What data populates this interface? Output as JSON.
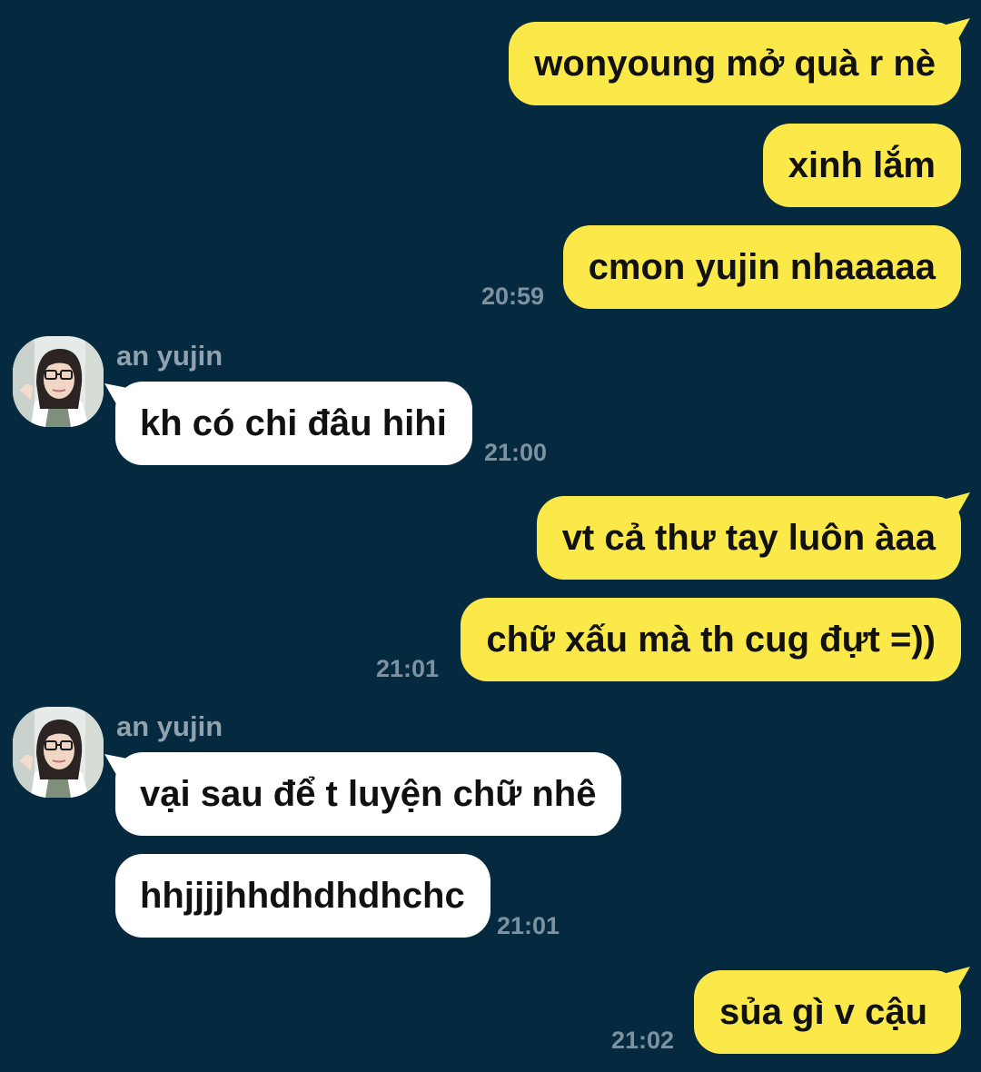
{
  "theme": {
    "background": "#052a40",
    "outgoing_bubble": "#fbe94a",
    "incoming_bubble": "#ffffff",
    "timestamp_color": "#7d92a0",
    "sender_color": "#8fa2ad"
  },
  "messages": [
    {
      "text": "wonyoung mở quà r nè"
    },
    {
      "text": "xinh lắm"
    },
    {
      "text": "cmon yujin nhaaaaa",
      "time": "20:59"
    },
    {
      "sender": "an yujin",
      "text": "kh có chi đâu hihi",
      "time": "21:00"
    },
    {
      "text": "vt cả thư tay luôn àaa"
    },
    {
      "text": "chữ xấu mà th cug đựt =))",
      "time": "21:01"
    },
    {
      "sender": "an yujin",
      "text": "vại sau để t luyện chữ nhê"
    },
    {
      "text": "hhjjjjhhdhdhdhchc",
      "time": "21:01"
    },
    {
      "text": "sủa gì v cậu",
      "time": "21:02"
    }
  ],
  "icons": {
    "avatar": "profile-photo"
  }
}
